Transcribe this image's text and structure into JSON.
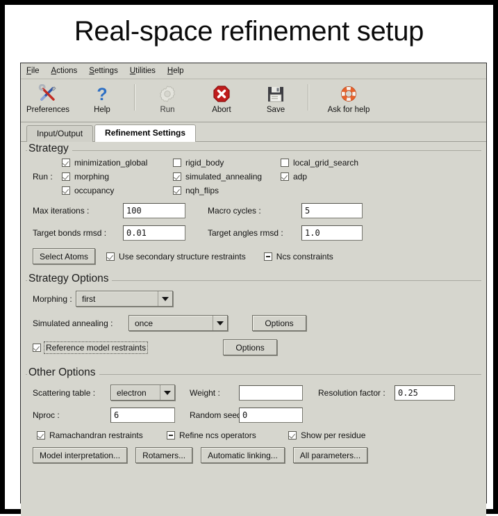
{
  "page_title": "Real-space refinement setup",
  "menubar": {
    "items": [
      {
        "label": "File",
        "mnemonic": "F"
      },
      {
        "label": "Actions",
        "mnemonic": "A"
      },
      {
        "label": "Settings",
        "mnemonic": "S"
      },
      {
        "label": "Utilities",
        "mnemonic": "U"
      },
      {
        "label": "Help",
        "mnemonic": "H"
      }
    ]
  },
  "toolbar": {
    "preferences_label": "Preferences",
    "help_label": "Help",
    "run_label": "Run",
    "abort_label": "Abort",
    "save_label": "Save",
    "ask_for_help_label": "Ask for help"
  },
  "tabs": [
    {
      "label": "Input/Output",
      "active": false
    },
    {
      "label": "Refinement Settings",
      "active": true
    }
  ],
  "strategy": {
    "title": "Strategy",
    "run_label": "Run :",
    "checkboxes": [
      {
        "label": "minimization_global",
        "state": "checked"
      },
      {
        "label": "rigid_body",
        "state": "unchecked"
      },
      {
        "label": "local_grid_search",
        "state": "unchecked"
      },
      {
        "label": "morphing",
        "state": "checked"
      },
      {
        "label": "simulated_annealing",
        "state": "checked"
      },
      {
        "label": "adp",
        "state": "checked"
      },
      {
        "label": "occupancy",
        "state": "checked"
      },
      {
        "label": "nqh_flips",
        "state": "checked"
      }
    ],
    "max_iterations_label": "Max iterations :",
    "max_iterations_value": "100",
    "macro_cycles_label": "Macro cycles :",
    "macro_cycles_value": "5",
    "target_bonds_label": "Target bonds rmsd :",
    "target_bonds_value": "0.01",
    "target_angles_label": "Target angles rmsd :",
    "target_angles_value": "1.0",
    "select_atoms_label": "Select Atoms",
    "secondary_structure_label": "Use secondary structure restraints",
    "secondary_structure_state": "checked",
    "ncs_constraints_label": "Ncs constraints",
    "ncs_constraints_state": "mixed"
  },
  "strategy_options": {
    "title": "Strategy Options",
    "morphing_label": "Morphing :",
    "morphing_value": "first",
    "simulated_annealing_label": "Simulated annealing :",
    "simulated_annealing_value": "once",
    "sa_options_label": "Options",
    "reference_model_label": "Reference model restraints",
    "reference_model_state": "checked",
    "reference_options_label": "Options"
  },
  "other_options": {
    "title": "Other Options",
    "scattering_table_label": "Scattering table :",
    "scattering_table_value": "electron",
    "weight_label": "Weight :",
    "weight_value": "",
    "resolution_factor_label": "Resolution factor :",
    "resolution_factor_value": "0.25",
    "nproc_label": "Nproc :",
    "nproc_value": "6",
    "random_seed_label": "Random seed :",
    "random_seed_value": "0",
    "ramachandran_label": "Ramachandran restraints",
    "ramachandran_state": "checked",
    "refine_ncs_label": "Refine ncs operators",
    "refine_ncs_state": "mixed",
    "show_per_residue_label": "Show per residue",
    "show_per_residue_state": "checked",
    "buttons": [
      {
        "label": "Model interpretation..."
      },
      {
        "label": "Rotamers..."
      },
      {
        "label": "Automatic linking..."
      },
      {
        "label": "All parameters..."
      }
    ]
  },
  "colors": {
    "window_bg": "#d6d6ce",
    "field_bg": "#ffffff",
    "abort_red": "#c01c1c",
    "help_blue": "#2d6fc4",
    "lifering_orange": "#e8622a"
  }
}
